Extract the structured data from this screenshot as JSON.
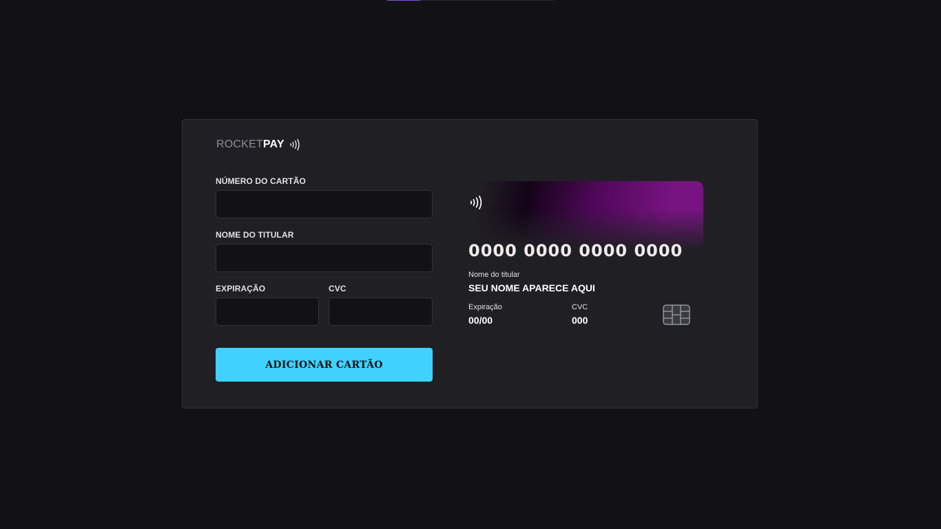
{
  "progress": {
    "value": 0.2,
    "color": "#8257e5"
  },
  "logo": {
    "part1": "ROCKET",
    "part2": "PAY",
    "icon": "contactless-icon"
  },
  "form": {
    "card_number": {
      "label": "NÚMERO DO CARTÃO",
      "value": "",
      "placeholder": ""
    },
    "holder_name": {
      "label": "NOME DO TITULAR",
      "value": "",
      "placeholder": ""
    },
    "expiration": {
      "label": "EXPIRAÇÃO",
      "value": "",
      "placeholder": ""
    },
    "cvc": {
      "label": "CVC",
      "value": "",
      "placeholder": ""
    },
    "submit_label": "ADICIONAR CARTÃO"
  },
  "card": {
    "number": "0000 0000 0000 0000",
    "holder_label": "Nome do titular",
    "holder_value": "SEU NOME APARECE AQUI",
    "expiration_label": "Expiração",
    "expiration_value": "00/00",
    "cvc_label": "CVC",
    "cvc_value": "000",
    "icons": [
      "contactless-icon",
      "chip-icon"
    ]
  },
  "colors": {
    "background": "#121214",
    "panel": "#202024",
    "input": "#121214",
    "button": "#3fd2ff",
    "card_gradient": "#78147f"
  }
}
